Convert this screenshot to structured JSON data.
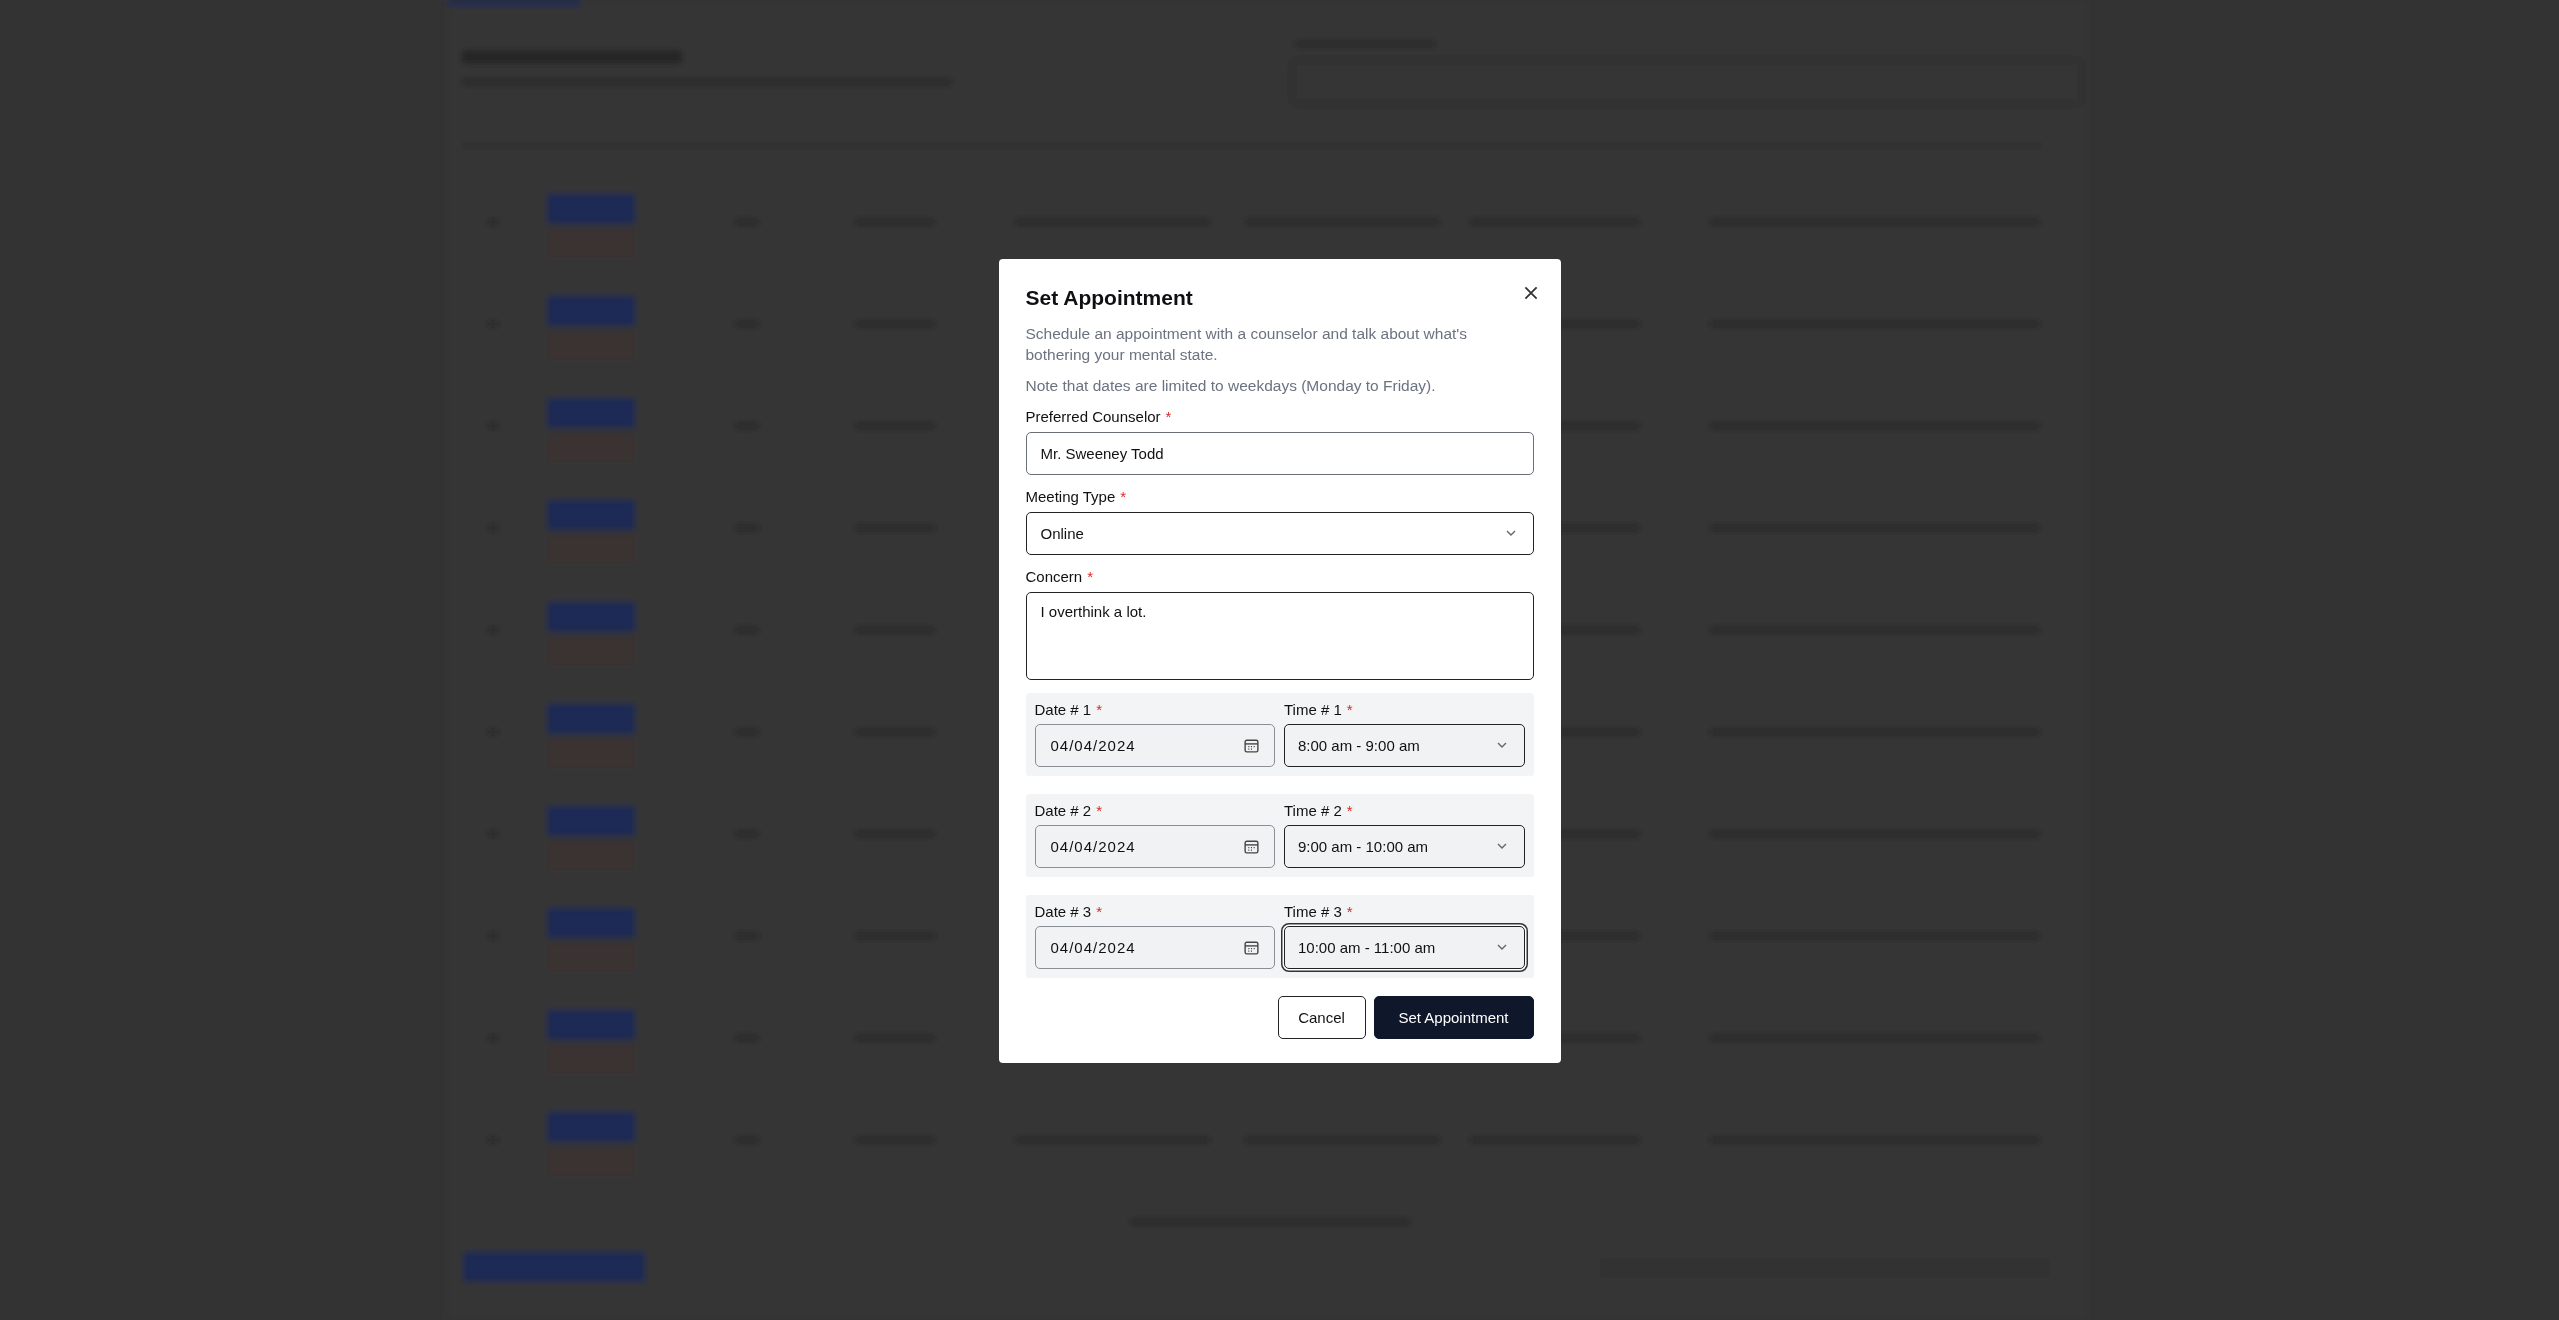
{
  "dialog": {
    "title": "Set Appointment",
    "description": "Schedule an appointment with a counselor and talk about what's bothering your mental state.",
    "note": "Note that dates are limited to weekdays (Monday to Friday).",
    "fields": [
      {
        "label": "Preferred Counselor",
        "required_mark": "*",
        "kind": "text",
        "value": "Mr. Sweeney Todd"
      },
      {
        "label": "Meeting Type",
        "required_mark": "*",
        "kind": "select",
        "value": "Online"
      },
      {
        "label": "Concern",
        "required_mark": "*",
        "kind": "textarea",
        "value": "I overthink a lot."
      }
    ],
    "schedule": [
      {
        "date_label": "Date # 1",
        "date_mark": "*",
        "date": "04/04/2024",
        "time_label": "Time # 1",
        "time_mark": "*",
        "time": "8:00 am - 9:00 am",
        "focused": false
      },
      {
        "date_label": "Date # 2",
        "date_mark": "*",
        "date": "04/04/2024",
        "time_label": "Time # 2",
        "time_mark": "*",
        "time": "9:00 am - 10:00 am",
        "focused": false
      },
      {
        "date_label": "Date # 3",
        "date_mark": "*",
        "date": "04/04/2024",
        "time_label": "Time # 3",
        "time_mark": "*",
        "time": "10:00 am - 11:00 am",
        "focused": true
      }
    ],
    "buttons": [
      {
        "label": "Cancel",
        "kind": "secondary"
      },
      {
        "label": "Set Appointment",
        "kind": "primary"
      }
    ]
  }
}
